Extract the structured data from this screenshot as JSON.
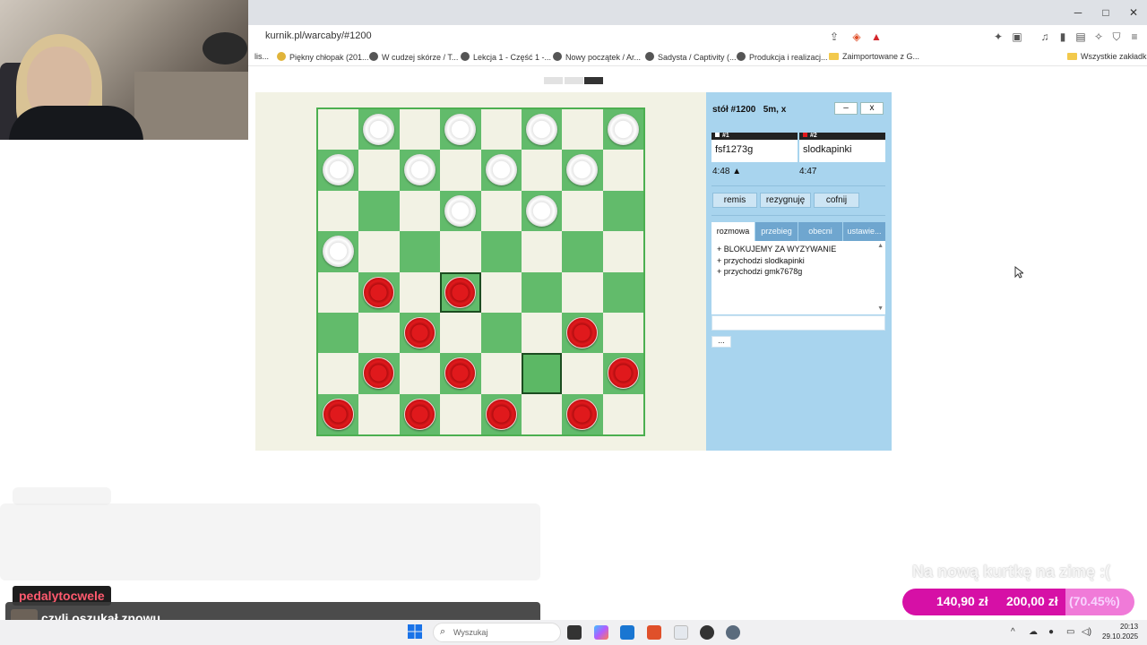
{
  "browser": {
    "url": "kurnik.pl/warcaby/#1200",
    "window_controls": [
      "─",
      "□",
      "✕"
    ],
    "bookmarks": [
      {
        "label": "lis..."
      },
      {
        "label": "Piękny chłopak (201..."
      },
      {
        "label": "W cudzej skórze / T..."
      },
      {
        "label": "Lekcja 1 - Część 1 -..."
      },
      {
        "label": "Nowy początek / Ar..."
      },
      {
        "label": "Sadysta / Captivity (..."
      },
      {
        "label": "Produkcja i realizacj..."
      },
      {
        "label": "Zaimportowane z G..."
      },
      {
        "label": "Wszystkie zakładki"
      }
    ]
  },
  "game": {
    "board": {
      "size": 8,
      "dark_squares_parity": 1,
      "pieces": [
        {
          "row": 0,
          "col": 1,
          "color": "white"
        },
        {
          "row": 0,
          "col": 3,
          "color": "white"
        },
        {
          "row": 0,
          "col": 5,
          "color": "white"
        },
        {
          "row": 0,
          "col": 7,
          "color": "white"
        },
        {
          "row": 1,
          "col": 0,
          "color": "white"
        },
        {
          "row": 1,
          "col": 2,
          "color": "white"
        },
        {
          "row": 1,
          "col": 4,
          "color": "white"
        },
        {
          "row": 1,
          "col": 6,
          "color": "white"
        },
        {
          "row": 2,
          "col": 3,
          "color": "white"
        },
        {
          "row": 2,
          "col": 5,
          "color": "white"
        },
        {
          "row": 3,
          "col": 0,
          "color": "white"
        },
        {
          "row": 4,
          "col": 1,
          "color": "red"
        },
        {
          "row": 4,
          "col": 3,
          "color": "red"
        },
        {
          "row": 5,
          "col": 2,
          "color": "red"
        },
        {
          "row": 5,
          "col": 6,
          "color": "red"
        },
        {
          "row": 6,
          "col": 1,
          "color": "red"
        },
        {
          "row": 6,
          "col": 3,
          "color": "red"
        },
        {
          "row": 6,
          "col": 7,
          "color": "red"
        },
        {
          "row": 7,
          "col": 0,
          "color": "red"
        },
        {
          "row": 7,
          "col": 2,
          "color": "red"
        },
        {
          "row": 7,
          "col": 4,
          "color": "red"
        },
        {
          "row": 7,
          "col": 6,
          "color": "red"
        }
      ],
      "highlighted": [
        {
          "row": 4,
          "col": 3
        },
        {
          "row": 6,
          "col": 5
        }
      ]
    },
    "colors": {
      "dark_square": "#62bb6b",
      "light_square": "#f2f2e4",
      "red_piece": "#e0191c",
      "white_piece": "#ffffff"
    }
  },
  "panel": {
    "title": "stół #1200",
    "mode": "5m, x",
    "minimize_label": "–",
    "close_label": "x",
    "players": [
      {
        "tag": "#1",
        "name": "fsf1273g",
        "time": "4:48 ▲",
        "marker_color": "#ffffff"
      },
      {
        "tag": "#2",
        "name": "slodkapinki",
        "time": "4:47",
        "marker_color": "#e0191c"
      }
    ],
    "actions": [
      "remis",
      "rezygnuję",
      "cofnij"
    ],
    "tabs": [
      "rozmowa",
      "przebieg",
      "obecni",
      "ustawie..."
    ],
    "active_tab": 0,
    "chat": [
      "+ BLOKUJEMY ZA WYZYWANIE",
      "+ przychodzi slodkapinki",
      "+ przychodzi gmk7678g"
    ],
    "more_label": "..."
  },
  "stream": {
    "chat_user": "pedalytocwele",
    "chat_message": "czyli oszukał znowu",
    "goal": {
      "title": "Na nową kurtkę na zimę :(",
      "current": "140,90 zł",
      "target": "200,00 zł",
      "percent_label": "(70.45%)",
      "fraction": 0.7045
    }
  },
  "taskbar": {
    "search_placeholder": "Wyszukaj",
    "time": "20:13",
    "date": "29.10.2025"
  }
}
